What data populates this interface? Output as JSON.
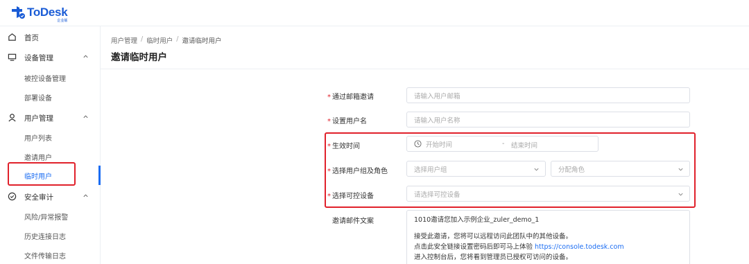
{
  "app": {
    "logo_name": "ToDesk",
    "logo_sub": "企业版",
    "brand_color": "#1a5cd6",
    "accent_color": "#1a6cf2",
    "highlight_color": "#e0202a"
  },
  "sidebar": {
    "home": {
      "label": "首页",
      "icon": "home-icon"
    },
    "device_mgmt": {
      "label": "设备管理",
      "icon": "monitor-icon",
      "items": [
        "被控设备管理",
        "部署设备"
      ]
    },
    "user_mgmt": {
      "label": "用户管理",
      "icon": "user-icon",
      "items": [
        "用户列表",
        "邀请用户",
        "临时用户"
      ]
    },
    "security_audit": {
      "label": "安全审计",
      "icon": "shield-icon",
      "items": [
        "风险/异常报警",
        "历史连接日志",
        "文件传输日志"
      ]
    }
  },
  "header": {
    "breadcrumb": [
      "用户管理",
      "临时用户",
      "邀请临时用户"
    ],
    "title": "邀请临时用户"
  },
  "form": {
    "email": {
      "label": "通过邮箱邀请",
      "placeholder": "请输入用户邮箱"
    },
    "username": {
      "label": "设置用户名",
      "placeholder": "请输入用户名称"
    },
    "valid_time": {
      "label": "生效时间",
      "start_placeholder": "开始时间",
      "separator": "-",
      "end_placeholder": "结束时间"
    },
    "group_role": {
      "label": "选择用户组及角色",
      "group_placeholder": "选择用户组",
      "role_placeholder": "分配角色"
    },
    "device": {
      "label": "选择可控设备",
      "placeholder": "请选择可控设备"
    },
    "mail_text": {
      "label": "邀请邮件文案",
      "line1": "1010邀请您加入示例企业_zuler_demo_1",
      "line2": "接受此邀请，您将可以远程访问此团队中的其他设备。",
      "line3_prefix": "点击此安全链接设置密码后即可马上体验 ",
      "line3_link": "https://console.todesk.com",
      "line4": "进入控制台后，您将看到管理员已授权可访问的设备。"
    }
  }
}
